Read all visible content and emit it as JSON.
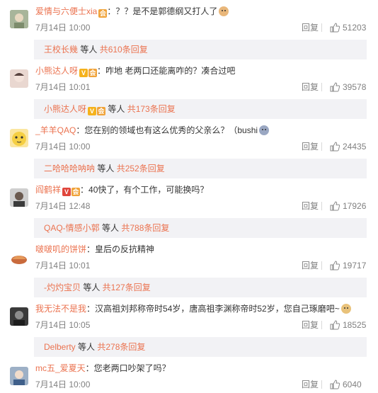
{
  "comments": [
    {
      "username": "爱情与六便士xia",
      "badges": [
        "vip-badge"
      ],
      "text": "：？？是不是郭德纲又打人了",
      "trailing_emoji": "cat-emoji",
      "time": "7月14日 10:00",
      "reply_label": "回复",
      "likes": "51203",
      "sub": {
        "user": "王校长幾",
        "mid": " 等人 ",
        "count": "共610条回复"
      }
    },
    {
      "username": "小熊达人呀",
      "badges": [
        "v-verified-badge",
        "vip-badge"
      ],
      "text": "：咋地 老两口还能离咋的？凑合过吧",
      "trailing_emoji": "",
      "time": "7月14日 10:01",
      "reply_label": "回复",
      "likes": "39578",
      "sub": {
        "user": "小熊达人呀",
        "mid": " 等人 ",
        "count": "共173条回复"
      }
    },
    {
      "username": "_羊羊QAQ",
      "badges": [],
      "text": "：您在别的领域也有这么优秀的父亲么？（bushi",
      "trailing_emoji": "sweat-emoji",
      "time": "7月14日 10:00",
      "reply_label": "回复",
      "likes": "24435",
      "sub": {
        "user": "二哈哈哈呐呐",
        "mid": " 等人 ",
        "count": "共252条回复"
      }
    },
    {
      "username": "阎鹤祥",
      "badges": [
        "v-verified-badge",
        "vip-badge"
      ],
      "text": "：40快了，有个工作，可能换吗？",
      "trailing_emoji": "",
      "time": "7月14日 12:48",
      "reply_label": "回复",
      "likes": "17926",
      "sub": {
        "user": "QAQ-情感小郭",
        "mid": " 等人 ",
        "count": "共788条回复"
      }
    },
    {
      "username": "啵啵叽的饼饼",
      "badges": [],
      "text": "：皇后の反抗精神",
      "trailing_emoji": "",
      "time": "7月14日 10:01",
      "reply_label": "回复",
      "likes": "19717",
      "sub": {
        "user": "-灼灼宝贝",
        "mid": " 等人 ",
        "count": "共127条回复"
      }
    },
    {
      "username": "我无法不是我",
      "badges": [],
      "text": "：汉高祖刘邦称帝时54岁，唐高祖李渊称帝时52岁，您自己琢磨吧~",
      "trailing_emoji": "dog-emoji",
      "time": "7月14日 10:05",
      "reply_label": "回复",
      "likes": "18525",
      "sub": {
        "user": "Delberty",
        "mid": " 等人 ",
        "count": "共278条回复"
      }
    },
    {
      "username": "mc五_爱夏天",
      "badges": [],
      "text": "：您老两口吵架了吗？",
      "trailing_emoji": "",
      "time": "7月14日 10:00",
      "reply_label": "回复",
      "likes": "6040"
    }
  ],
  "colors": {
    "username": "#eb7350",
    "text": "#333333",
    "meta": "#808080",
    "sub_bg": "#f2f2f5"
  }
}
